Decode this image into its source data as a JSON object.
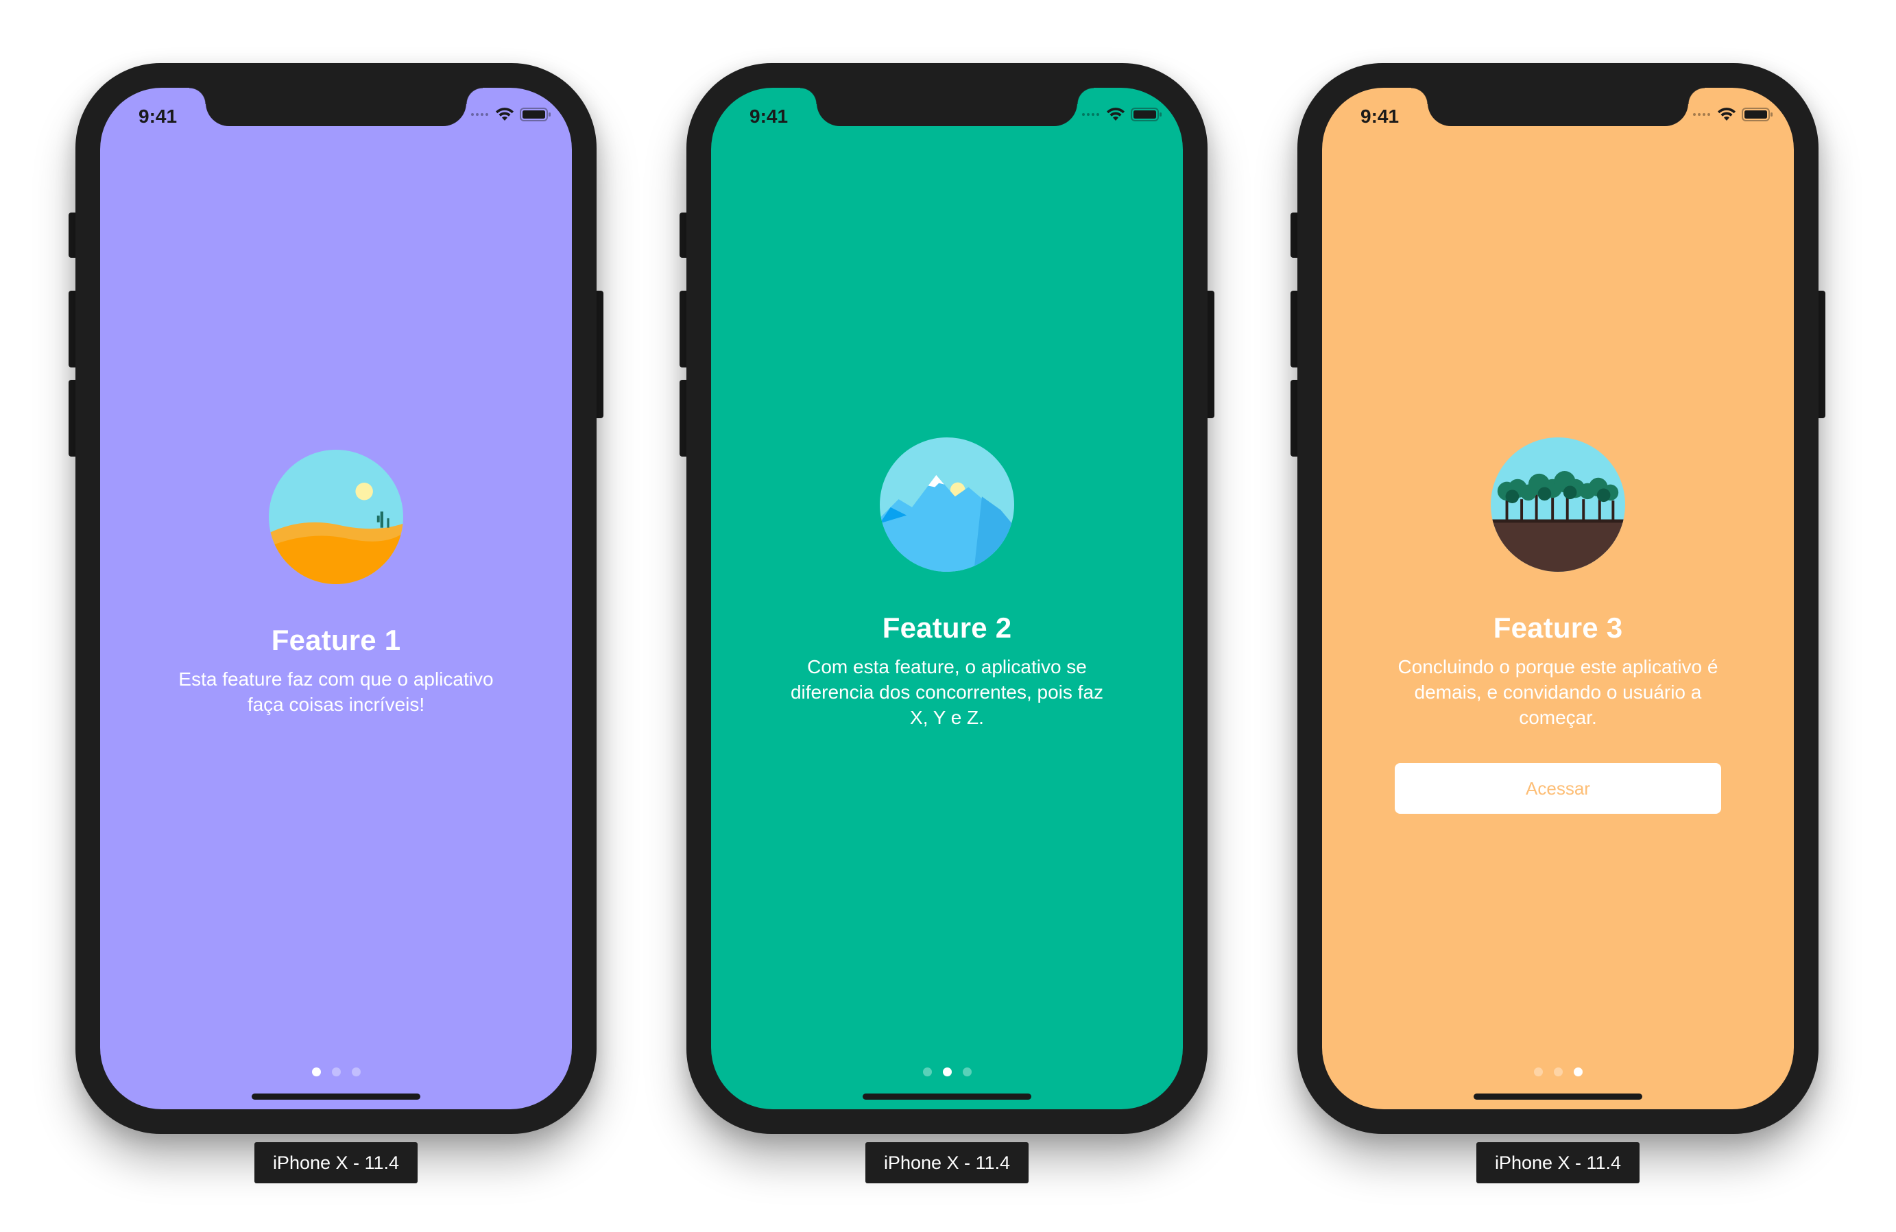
{
  "status_bar": {
    "time": "9:41"
  },
  "screens": [
    {
      "background": "#a29bfe",
      "illustration": "desert-landscape-icon",
      "title": "Feature 1",
      "description": "Esta feature faz com que o aplicativo faça coisas incríveis!",
      "active_page": 1
    },
    {
      "background": "#00b894",
      "illustration": "mountain-landscape-icon",
      "title": "Feature 2",
      "description": "Com esta feature, o aplicativo se diferencia dos concorrentes, pois faz X, Y e Z.",
      "active_page": 2
    },
    {
      "background": "#fdbe76",
      "illustration": "forest-landscape-icon",
      "title": "Feature 3",
      "description": "Concluindo o porque este aplicativo é demais, e convidando o usuário a começar.",
      "button_label": "Acessar",
      "active_page": 3
    }
  ],
  "device_label": "iPhone X - 11.4"
}
